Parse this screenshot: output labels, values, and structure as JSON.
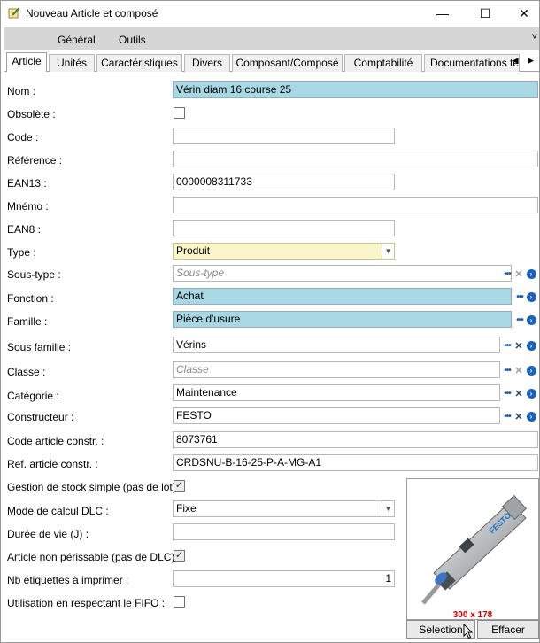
{
  "window": {
    "title": "Nouveau Article et composé",
    "minimize": "—",
    "maximize": "☐",
    "close": "✕"
  },
  "ribbon": {
    "tabs": [
      "Général",
      "Outils"
    ],
    "collapse": "˅"
  },
  "tabs": [
    "Article",
    "Unités",
    "Caractéristiques",
    "Divers",
    "Composant/Composé",
    "Comptabilité",
    "Documentations tech"
  ],
  "tab_arrows": "◀ ▶",
  "form": {
    "nom": {
      "label": "Nom :",
      "value": "Vérin diam 16 course 25"
    },
    "obsolete": {
      "label": "Obsolète :",
      "checked": false
    },
    "code": {
      "label": "Code :",
      "value": ""
    },
    "reference": {
      "label": "Référence :",
      "value": ""
    },
    "ean13": {
      "label": "EAN13 :",
      "value": "0000008311733"
    },
    "mnemo": {
      "label": "Mnémo :",
      "value": ""
    },
    "ean8": {
      "label": "EAN8 :",
      "value": ""
    },
    "type": {
      "label": "Type :",
      "value": "Produit"
    },
    "sous_type": {
      "label": "Sous-type :",
      "placeholder": "Sous-type"
    },
    "fonction": {
      "label": "Fonction :",
      "value": "Achat"
    },
    "famille": {
      "label": "Famille :",
      "value": "Pièce d'usure"
    },
    "sous_famille": {
      "label": "Sous famille :",
      "value": "Vérins"
    },
    "classe": {
      "label": "Classe :",
      "placeholder": "Classe"
    },
    "categorie": {
      "label": "Catégorie :",
      "value": "Maintenance"
    },
    "constructeur": {
      "label": "Constructeur :",
      "value": "FESTO"
    },
    "code_constr": {
      "label": "Code article constr. :",
      "value": "8073761"
    },
    "ref_constr": {
      "label": "Ref. article constr. :",
      "value": "CRDSNU-B-16-25-P-A-MG-A1"
    },
    "gestion_stock": {
      "label": "Gestion de stock simple (pas de lot) :",
      "checked": true
    },
    "mode_dlc": {
      "label": "Mode de calcul DLC :",
      "value": "Fixe"
    },
    "duree_vie": {
      "label": "Durée de vie (J) :",
      "value": ""
    },
    "non_perissable": {
      "label": "Article non périssable (pas de DLC) :",
      "checked": true
    },
    "nb_etiquettes": {
      "label": "Nb étiquettes à imprimer :",
      "value": "1"
    },
    "fifo": {
      "label": "Utilisation en respectant le FIFO :",
      "checked": false
    }
  },
  "icons": {
    "browse": "•••",
    "clear": "✕",
    "open": "›"
  },
  "image": {
    "brand": "FESTO",
    "caption": "300 x 178",
    "select_button": "Selection",
    "clear_button": "Effacer"
  },
  "colors": {
    "required_blue": "#a9d8e5",
    "highlight_yellow": "#fbf6c9",
    "ribbon_gray": "#d6d6d6",
    "caption_red": "#d00000"
  }
}
